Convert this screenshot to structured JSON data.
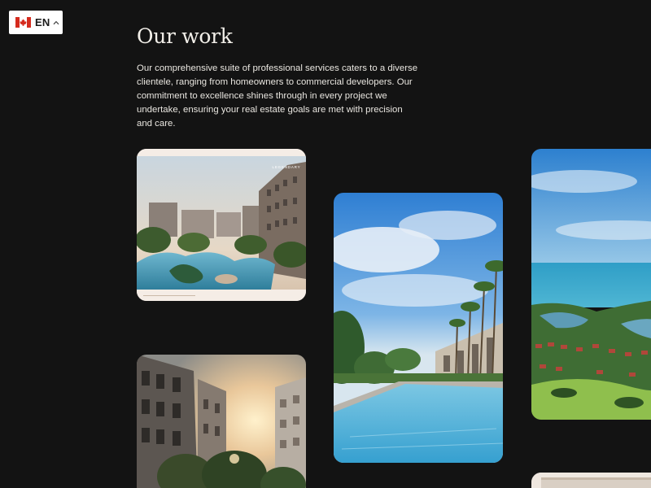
{
  "language_selector": {
    "label": "EN",
    "flag_icon": "canada-flag-icon",
    "chevron_icon": "chevron-up-icon"
  },
  "section": {
    "title": "Our work",
    "intro": "Our comprehensive suite of professional services caters to a diverse clientele, ranging from homeowners to commercial developers. Our commitment to excellence shines through in every project we undertake, ensuring your real estate goals are met with precision and care."
  },
  "projects": {
    "card_1": {
      "image": "resort-condominium-pool-rendering",
      "brand_text": "LEGENDARY"
    },
    "card_2": {
      "image": "villa-pool-with-palm-trees"
    },
    "card_3": {
      "image": "aerial-coastal-golf-resort"
    },
    "card_4": {
      "image": "condominium-sunset-rendering"
    },
    "card_5": {
      "image": "interior-preview"
    }
  },
  "colors": {
    "background": "#131313",
    "text": "#f2efe9",
    "card_frame": "#f5ede6"
  }
}
